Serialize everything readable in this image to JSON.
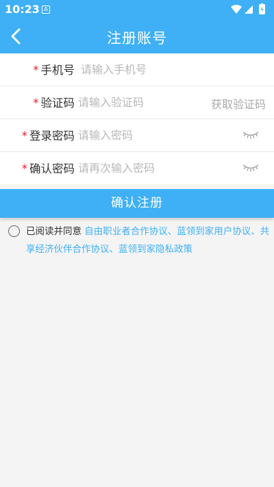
{
  "status_bar": {
    "time": "10:23",
    "app_icon": "A"
  },
  "header": {
    "title": "注册账号"
  },
  "form": {
    "phone": {
      "label": "手机号",
      "required": "*",
      "placeholder": "请输入手机号"
    },
    "code": {
      "label": "验证码",
      "required": "*",
      "placeholder": "请输入验证码",
      "get_code": "获取验证码"
    },
    "password": {
      "label": "登录密码",
      "required": "*",
      "placeholder": "请输入密码"
    },
    "confirm": {
      "label": "确认密码",
      "required": "*",
      "placeholder": "请再次输入密码"
    }
  },
  "submit_label": "确认注册",
  "agreement": {
    "prefix": "已阅读并同意 ",
    "links": [
      "自由职业者合作协议",
      "蓝领到家用户协议",
      "共享经济伙伴合作协议",
      "蓝领到家隐私政策"
    ],
    "separator": "、"
  },
  "colors": {
    "accent": "#3fb0f5",
    "required": "#e6212a"
  }
}
